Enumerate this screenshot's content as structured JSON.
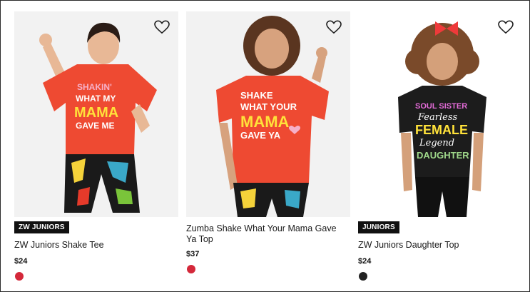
{
  "products": [
    {
      "badge": "ZW JUNIORS",
      "title": "ZW Juniors Shake Tee",
      "price": "$24",
      "swatch_color": "#d4283a",
      "shirt_color": "#ee4a32",
      "shirt_text": [
        "SHAKIN'",
        "WHAT MY",
        "MAMA",
        "GAVE ME"
      ],
      "favorite_icon": "heart-outline-icon"
    },
    {
      "badge": "",
      "title": "Zumba Shake What Your Mama Gave Ya Top",
      "price": "$37",
      "swatch_color": "#d4283a",
      "shirt_color": "#ee4a32",
      "shirt_text": [
        "SHAKE",
        "WHAT YOUR",
        "MAMA",
        "GAVE YA"
      ],
      "favorite_icon": "heart-outline-icon"
    },
    {
      "badge": "JUNIORS",
      "title": "ZW Juniors Daughter Top",
      "price": "$24",
      "swatch_color": "#222222",
      "shirt_color": "#1c1c1c",
      "shirt_text": [
        "SOUL SISTER",
        "Fearless",
        "FEMALE",
        "Legend",
        "DAUGHTER"
      ],
      "favorite_icon": "heart-outline-icon"
    }
  ]
}
